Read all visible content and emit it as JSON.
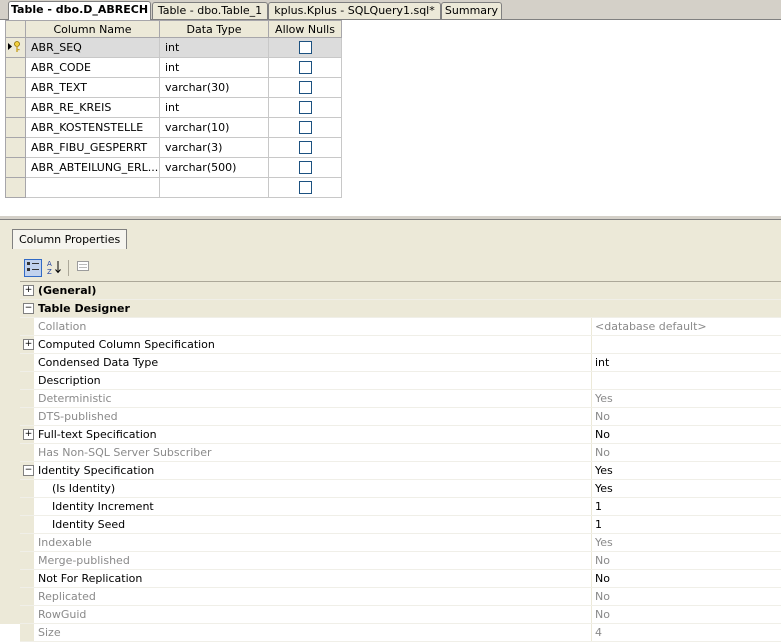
{
  "tabs": [
    {
      "label": "Table - dbo.D_ABRECH",
      "active": true
    },
    {
      "label": "Table - dbo.Table_1",
      "active": false
    },
    {
      "label": "kplus.Kplus - SQLQuery1.sql*",
      "active": false
    },
    {
      "label": "Summary",
      "active": false
    }
  ],
  "grid": {
    "headers": [
      "Column Name",
      "Data Type",
      "Allow Nulls"
    ],
    "rows": [
      {
        "name": "ABR_SEQ",
        "type": "int",
        "nulls": false,
        "current": true,
        "key": true
      },
      {
        "name": "ABR_CODE",
        "type": "int",
        "nulls": false
      },
      {
        "name": "ABR_TEXT",
        "type": "varchar(30)",
        "nulls": false
      },
      {
        "name": "ABR_RE_KREIS",
        "type": "int",
        "nulls": false
      },
      {
        "name": "ABR_KOSTENSTELLE",
        "type": "varchar(10)",
        "nulls": false
      },
      {
        "name": "ABR_FIBU_GESPERRT",
        "type": "varchar(3)",
        "nulls": false
      },
      {
        "name": "ABR_ABTEILUNG_ERL...",
        "type": "varchar(500)",
        "nulls": false
      },
      {
        "name": "",
        "type": "",
        "nulls": false
      }
    ],
    "current_row_icons": "arrow-key-icon"
  },
  "column_properties": {
    "tab_label": "Column Properties",
    "toolbar": {
      "categorized_icon": "categorized-icon",
      "alphabetical_icon": "alphabetical-sort-icon",
      "property_pages_icon": "property-pages-icon"
    },
    "rows": [
      {
        "name": "(General)",
        "value": "",
        "kind": "cat",
        "expander": "+"
      },
      {
        "name": "Table Designer",
        "value": "",
        "kind": "cat",
        "expander": "−"
      },
      {
        "name": "Collation",
        "value": "<database default>",
        "kind": "dis"
      },
      {
        "name": "Computed Column Specification",
        "value": "",
        "kind": "norm",
        "expander": "+"
      },
      {
        "name": "Condensed Data Type",
        "value": "int",
        "kind": "norm"
      },
      {
        "name": "Description",
        "value": "",
        "kind": "norm"
      },
      {
        "name": "Deterministic",
        "value": "Yes",
        "kind": "dis"
      },
      {
        "name": "DTS-published",
        "value": "No",
        "kind": "dis"
      },
      {
        "name": "Full-text Specification",
        "value": "No",
        "kind": "norm",
        "expander": "+"
      },
      {
        "name": "Has Non-SQL Server Subscriber",
        "value": "No",
        "kind": "dis"
      },
      {
        "name": "Identity Specification",
        "value": "Yes",
        "kind": "norm",
        "expander": "−"
      },
      {
        "name": "(Is Identity)",
        "value": "Yes",
        "kind": "sub"
      },
      {
        "name": "Identity Increment",
        "value": "1",
        "kind": "sub"
      },
      {
        "name": "Identity Seed",
        "value": "1",
        "kind": "sub"
      },
      {
        "name": "Indexable",
        "value": "Yes",
        "kind": "dis"
      },
      {
        "name": "Merge-published",
        "value": "No",
        "kind": "dis"
      },
      {
        "name": "Not For Replication",
        "value": "No",
        "kind": "norm"
      },
      {
        "name": "Replicated",
        "value": "No",
        "kind": "dis"
      },
      {
        "name": "RowGuid",
        "value": "No",
        "kind": "dis"
      },
      {
        "name": "Size",
        "value": "4",
        "kind": "dis"
      }
    ]
  }
}
